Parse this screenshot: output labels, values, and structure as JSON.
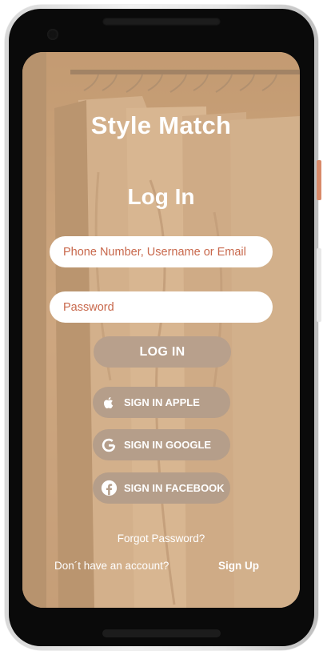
{
  "app": {
    "title": "Style Match",
    "heading": "Log In"
  },
  "form": {
    "username_placeholder": "Phone Number, Username or Email",
    "password_placeholder": "Password",
    "login_label": "LOG IN"
  },
  "social": [
    {
      "label": "SIGN IN APPLE",
      "icon": "apple-icon"
    },
    {
      "label": "SIGN IN GOOGLE",
      "icon": "google-icon"
    },
    {
      "label": "SIGN IN FACEBOOK",
      "icon": "facebook-icon"
    }
  ],
  "footer": {
    "forgot_password": "Forgot Password?",
    "no_account": "Don´t have an account?",
    "sign_up": "Sign Up"
  },
  "colors": {
    "overlay": "#d0aa84",
    "button": "#b8a08c",
    "placeholder": "#c8684c",
    "text": "#ffffff"
  }
}
